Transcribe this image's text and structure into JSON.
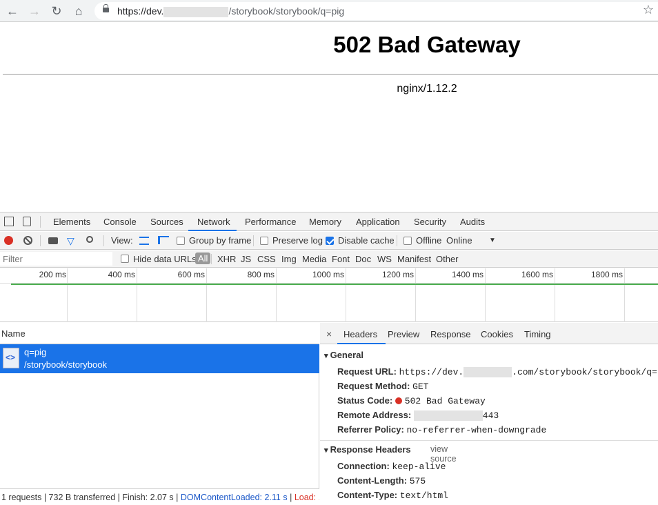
{
  "browser": {
    "url_prefix": "https://dev.",
    "url_suffix": "/storybook/storybook/q=pig"
  },
  "page": {
    "title": "502 Bad Gateway",
    "server": "nginx/1.12.2"
  },
  "devtools": {
    "tabs": [
      "Elements",
      "Console",
      "Sources",
      "Network",
      "Performance",
      "Memory",
      "Application",
      "Security",
      "Audits"
    ],
    "active_tab": "Network",
    "toolbar": {
      "view_label": "View:",
      "group_by_frame": "Group by frame",
      "preserve_log": "Preserve log",
      "disable_cache": "Disable cache",
      "offline": "Offline",
      "throttle": "Online"
    },
    "filter": {
      "placeholder": "Filter",
      "hide_data_urls": "Hide data URLs",
      "types": [
        "All",
        "XHR",
        "JS",
        "CSS",
        "Img",
        "Media",
        "Font",
        "Doc",
        "WS",
        "Manifest",
        "Other"
      ]
    },
    "timeline_ticks": [
      "200 ms",
      "400 ms",
      "600 ms",
      "800 ms",
      "1000 ms",
      "1200 ms",
      "1400 ms",
      "1600 ms",
      "1800 ms"
    ],
    "list": {
      "name_header": "Name",
      "request": {
        "name": "q=pig",
        "path": "/storybook/storybook"
      }
    },
    "status": {
      "summary": "1 requests | 732 B transferred | Finish: 2.07 s | ",
      "dcl": "DOMContentLoaded: 2.11 s",
      "sep": " | ",
      "load": "Load: ..."
    },
    "details": {
      "close": "×",
      "tabs": [
        "Headers",
        "Preview",
        "Response",
        "Cookies",
        "Timing"
      ],
      "general_title": "General",
      "request_url_key": "Request URL:",
      "request_url_prefix": "https://dev.",
      "request_url_suffix": ".com/storybook/storybook/q=pig",
      "request_method_key": "Request Method:",
      "request_method": "GET",
      "status_code_key": "Status Code:",
      "status_code": "502 Bad Gateway",
      "remote_address_key": "Remote Address:",
      "remote_port": "443",
      "referrer_policy_key": "Referrer Policy:",
      "referrer_policy": "no-referrer-when-downgrade",
      "response_headers_title": "Response Headers",
      "view_source": "view source",
      "connection_key": "Connection:",
      "connection": "keep-alive",
      "content_length_key": "Content-Length:",
      "content_length": "575",
      "content_type_key": "Content-Type:",
      "content_type": "text/html"
    }
  }
}
